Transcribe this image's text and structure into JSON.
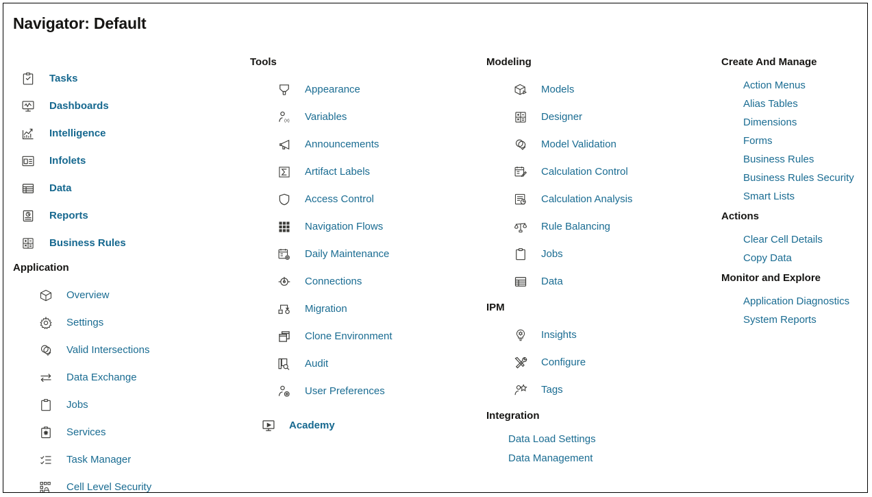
{
  "window": {
    "title": "Navigator: Default"
  },
  "colors": {
    "link": "#1a6c92",
    "link_bold": "#16688f",
    "header_text": "#161513",
    "icon": "#3b3b38",
    "border": "#000000",
    "background": "#ffffff"
  },
  "columns": {
    "column1": {
      "top_items": [
        {
          "label": "Tasks",
          "icon": "clipboard-check-icon"
        },
        {
          "label": "Dashboards",
          "icon": "monitor-chart-icon"
        },
        {
          "label": "Intelligence",
          "icon": "chart-trend-icon"
        },
        {
          "label": "Infolets",
          "icon": "infolet-panels-icon"
        },
        {
          "label": "Data",
          "icon": "grid-table-icon"
        },
        {
          "label": "Reports",
          "icon": "report-pie-icon"
        },
        {
          "label": "Business Rules",
          "icon": "calculator-grid-icon"
        }
      ],
      "application": {
        "header": "Application",
        "items": [
          {
            "label": "Overview",
            "icon": "cube-icon"
          },
          {
            "label": "Settings",
            "icon": "gear-icon"
          },
          {
            "label": "Valid Intersections",
            "icon": "venn-check-icon"
          },
          {
            "label": "Data Exchange",
            "icon": "exchange-arrows-icon"
          },
          {
            "label": "Jobs",
            "icon": "clipboard-icon"
          },
          {
            "label": "Services",
            "icon": "services-box-icon"
          },
          {
            "label": "Task Manager",
            "icon": "checklist-icon"
          },
          {
            "label": "Cell Level Security",
            "icon": "cell-lock-icon"
          }
        ]
      }
    },
    "column2": {
      "header": "Tools",
      "items": [
        {
          "label": "Appearance",
          "icon": "paint-marker-icon"
        },
        {
          "label": "Variables",
          "icon": "user-variable-icon"
        },
        {
          "label": "Announcements",
          "icon": "megaphone-icon"
        },
        {
          "label": "Artifact Labels",
          "icon": "sigma-box-icon"
        },
        {
          "label": "Access Control",
          "icon": "shield-icon"
        },
        {
          "label": "Navigation Flows",
          "icon": "nav-grid-icon"
        },
        {
          "label": "Daily Maintenance",
          "icon": "calendar-gear-icon"
        },
        {
          "label": "Connections",
          "icon": "connection-node-icon"
        },
        {
          "label": "Migration",
          "icon": "migration-arrow-icon"
        },
        {
          "label": "Clone Environment",
          "icon": "copy-windows-icon"
        },
        {
          "label": "Audit",
          "icon": "audit-search-icon"
        },
        {
          "label": "User Preferences",
          "icon": "user-gear-icon"
        }
      ],
      "academy": {
        "label": "Academy",
        "icon": "play-monitor-icon"
      }
    },
    "column3": {
      "modeling": {
        "header": "Modeling",
        "items": [
          {
            "label": "Models",
            "icon": "cube-play-icon"
          },
          {
            "label": "Designer",
            "icon": "calculator-grid-icon"
          },
          {
            "label": "Model Validation",
            "icon": "venn-check-icon"
          },
          {
            "label": "Calculation Control",
            "icon": "calendar-pencil-icon"
          },
          {
            "label": "Calculation Analysis",
            "icon": "report-analysis-icon"
          },
          {
            "label": "Rule Balancing",
            "icon": "balance-scale-icon"
          },
          {
            "label": "Jobs",
            "icon": "clipboard-icon"
          },
          {
            "label": "Data",
            "icon": "grid-table-icon"
          }
        ]
      },
      "ipm": {
        "header": "IPM",
        "items": [
          {
            "label": "Insights",
            "icon": "lightbulb-icon"
          },
          {
            "label": "Configure",
            "icon": "tools-cross-icon"
          },
          {
            "label": "Tags",
            "icon": "user-star-icon"
          }
        ]
      },
      "integration": {
        "header": "Integration",
        "items": [
          {
            "label": "Data Load Settings"
          },
          {
            "label": "Data Management"
          }
        ]
      }
    },
    "column4": {
      "create_and_manage": {
        "header": "Create And Manage",
        "items": [
          {
            "label": "Action Menus"
          },
          {
            "label": "Alias Tables"
          },
          {
            "label": "Dimensions"
          },
          {
            "label": "Forms"
          },
          {
            "label": "Business Rules"
          },
          {
            "label": "Business Rules Security"
          },
          {
            "label": "Smart Lists"
          }
        ]
      },
      "actions": {
        "header": "Actions",
        "items": [
          {
            "label": "Clear Cell Details"
          },
          {
            "label": "Copy Data"
          }
        ]
      },
      "monitor_and_explore": {
        "header": "Monitor and Explore",
        "items": [
          {
            "label": "Application Diagnostics"
          },
          {
            "label": "System Reports"
          }
        ]
      }
    }
  }
}
